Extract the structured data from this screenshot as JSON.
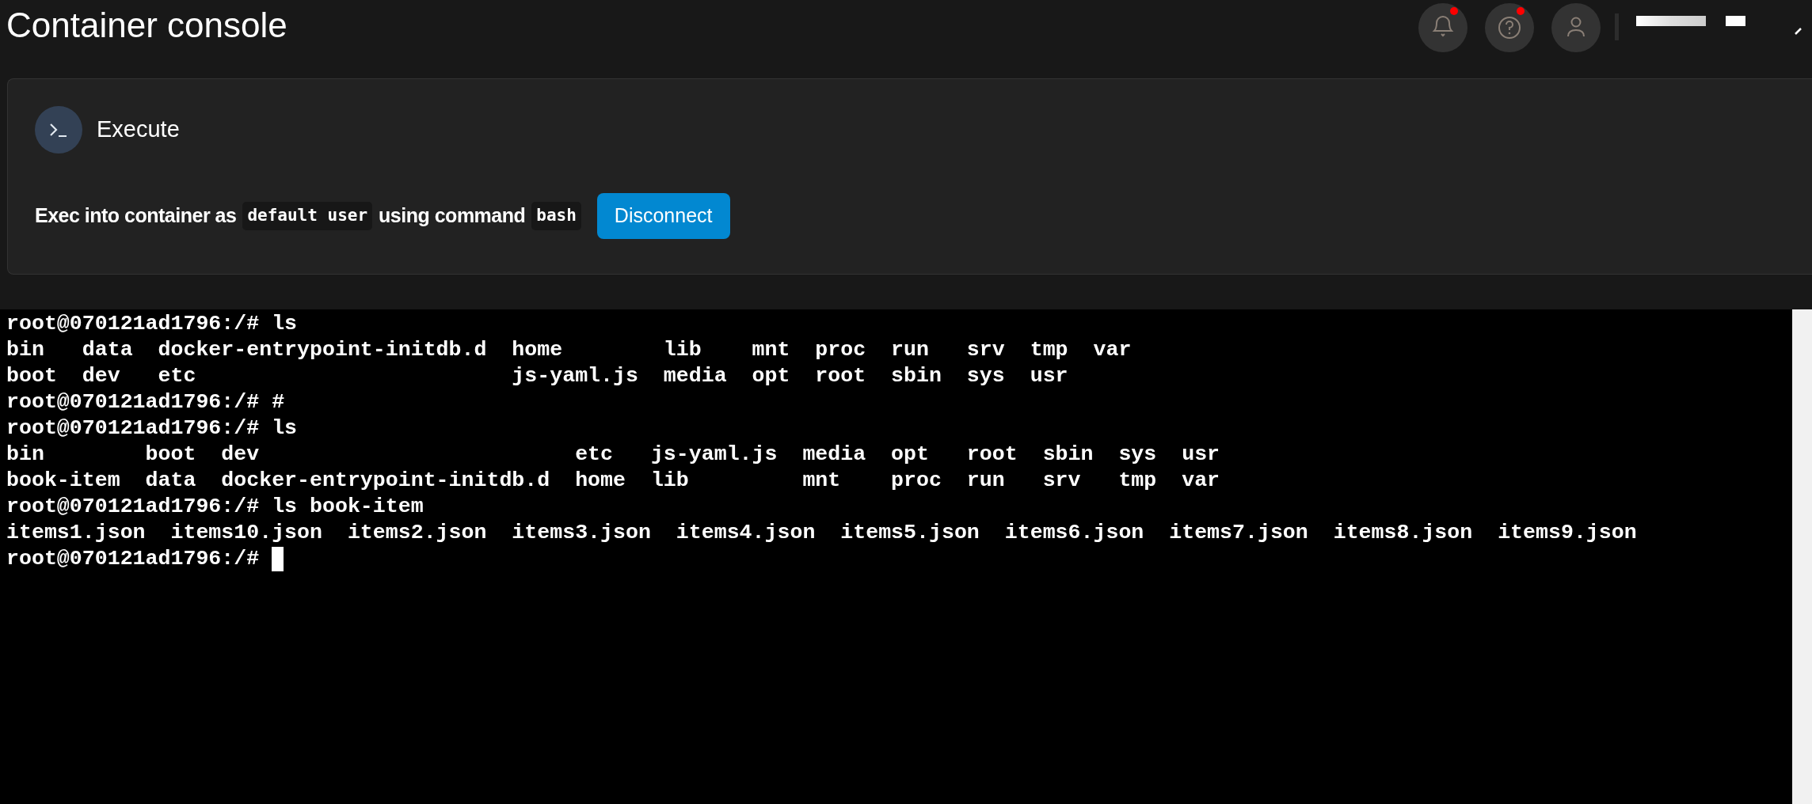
{
  "header": {
    "title": "Container console",
    "actions": [
      {
        "kind": "bell",
        "badge": true
      },
      {
        "kind": "help",
        "badge": true
      },
      {
        "kind": "user",
        "badge": false
      }
    ]
  },
  "execute_card": {
    "title": "Execute",
    "description": [
      {
        "kind": "text",
        "text": "Exec into container as"
      },
      {
        "kind": "code",
        "text": "default user"
      },
      {
        "kind": "text",
        "text": "using command"
      },
      {
        "kind": "code",
        "text": "bash"
      }
    ],
    "button": "Disconnect"
  },
  "terminal": {
    "lines": [
      "root@070121ad1796:/# ls",
      "bin   data  docker-entrypoint-initdb.d  home        lib    mnt  proc  run   srv  tmp  var",
      "boot  dev   etc                         js-yaml.js  media  opt  root  sbin  sys  usr",
      "root@070121ad1796:/# #",
      "root@070121ad1796:/# ls",
      "bin        boot  dev                         etc   js-yaml.js  media  opt   root  sbin  sys  usr",
      "book-item  data  docker-entrypoint-initdb.d  home  lib         mnt    proc  run   srv   tmp  var",
      "root@070121ad1796:/# ls book-item",
      "items1.json  items10.json  items2.json  items3.json  items4.json  items5.json  items6.json  items7.json  items8.json  items9.json",
      "root@070121ad1796:/# "
    ],
    "cursor": true
  }
}
